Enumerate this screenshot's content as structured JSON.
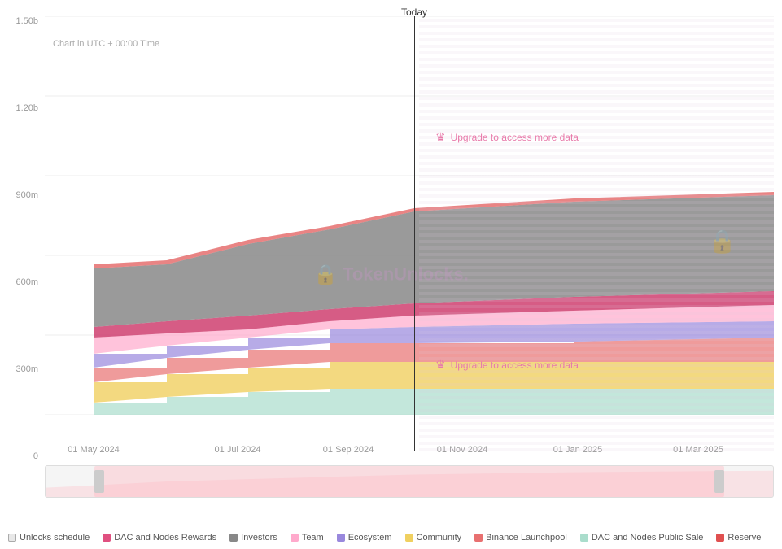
{
  "chart": {
    "title": "Today",
    "subtitle": "Chart in UTC + 00:00 Time",
    "y_labels": [
      "0",
      "300m",
      "600m",
      "900m",
      "1.20b",
      "1.50b"
    ],
    "x_labels": [
      "01 May 2024",
      "01 Jul 2024",
      "01 Sep 2024",
      "01 Nov 2024",
      "01 Jan 2025",
      "01 Mar 2025"
    ],
    "upgrade_top": "Upgrade to access more data",
    "upgrade_bottom": "Upgrade to access more data",
    "watermark": "TokenUnlocks."
  },
  "legend": {
    "items": [
      {
        "label": "Unlocks schedule",
        "color": "#e8e8e8",
        "border": "#aaa"
      },
      {
        "label": "DAC and Nodes Rewards",
        "color": "#e05080"
      },
      {
        "label": "Investors",
        "color": "#888888"
      },
      {
        "label": "Team",
        "color": "#ffaacc"
      },
      {
        "label": "Ecosystem",
        "color": "#9988dd"
      },
      {
        "label": "Community",
        "color": "#f0d060"
      },
      {
        "label": "Binance Launchpool",
        "color": "#e87070"
      },
      {
        "label": "DAC and Nodes Public Sale",
        "color": "#aaddcc"
      },
      {
        "label": "Reserve",
        "color": "#e05050"
      }
    ]
  }
}
